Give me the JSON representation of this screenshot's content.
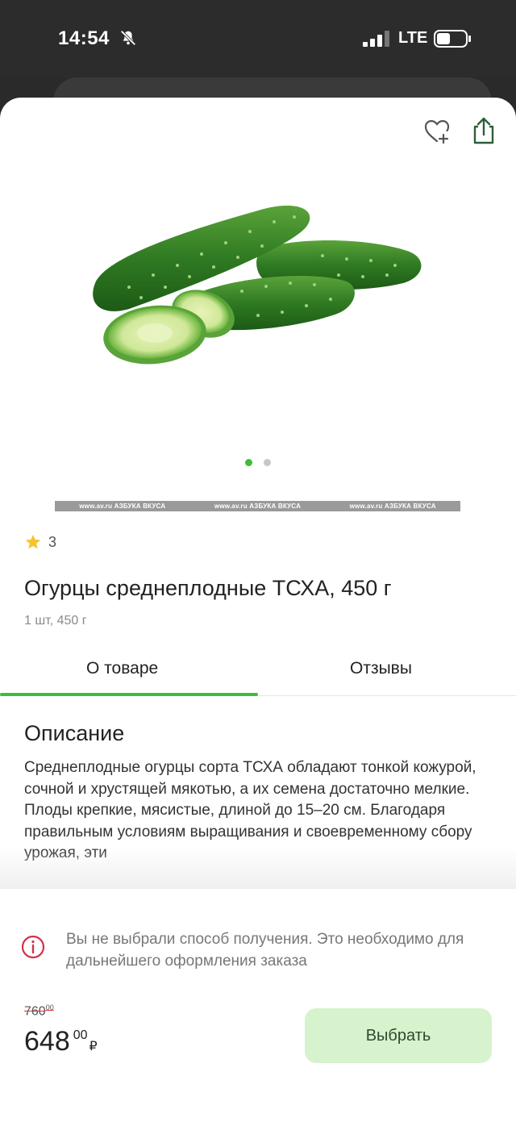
{
  "status_bar": {
    "time": "14:54",
    "network": "LTE"
  },
  "header": {
    "wishlist_icon": "heart-plus-icon",
    "share_icon": "share-icon"
  },
  "gallery": {
    "image_name": "cucumbers-image",
    "dots_total": 2,
    "active_dot": 1,
    "watermark_segments": [
      "www.av.ru  АЗБУКА ВКУСА",
      "www.av.ru  АЗБУКА ВКУСА",
      "www.av.ru  АЗБУКА ВКУСА"
    ]
  },
  "product": {
    "rating": "3",
    "title": "Огурцы среднеплодные ТСХА, 450 г",
    "subtitle": "1 шт, 450 г"
  },
  "tabs": {
    "about": "О товаре",
    "reviews": "Отзывы"
  },
  "description": {
    "heading": "Описание",
    "text": "Среднеплодные огурцы сорта ТСХА обладают тонкой кожурой, сочной и хрустящей мякотью, а их семена достаточно мелкие. Плоды крепкие, мясистые, длиной до 15–20 см. Благодаря правильным условиям выращивания и своевременному сбору урожая, эти"
  },
  "checkout": {
    "notice": "Вы не выбрали способ получения. Это необходимо для дальнейшего оформления заказа",
    "old_price": "760",
    "old_price_cents": "00",
    "price": "648",
    "price_cents": "00",
    "currency": "₽",
    "select_button": "Выбрать"
  },
  "colors": {
    "accent": "#3cbd3c",
    "button_bg": "#d6f3cd"
  }
}
